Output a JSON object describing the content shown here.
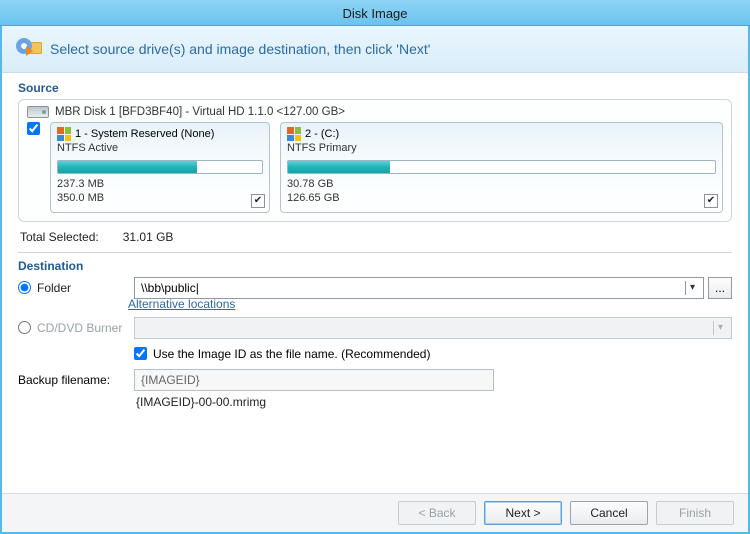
{
  "title": "Disk Image",
  "banner": "Select source drive(s) and image destination, then click 'Next'",
  "source": {
    "heading": "Source",
    "disk_label": "MBR Disk 1 [BFD3BF40] - Virtual HD 1.1.0  <127.00 GB>",
    "partitions": [
      {
        "title": "1 - System Reserved (None)",
        "fs": "NTFS Active",
        "used": "237.3 MB",
        "total": "350.0 MB",
        "pct": 68
      },
      {
        "title": "2 -  (C:)",
        "fs": "NTFS Primary",
        "used": "30.78 GB",
        "total": "126.65 GB",
        "pct": 24
      }
    ],
    "total_label": "Total Selected:",
    "total_value": "31.01 GB"
  },
  "dest": {
    "heading": "Destination",
    "folder_label": "Folder",
    "folder_value": "\\\\bb\\public|",
    "alt_link": "Alternative locations",
    "burner_label": "CD/DVD Burner",
    "use_imageid_label": "Use the Image ID as the file name.  (Recommended)",
    "filename_label": "Backup filename:",
    "filename_value": "{IMAGEID}",
    "preview": "{IMAGEID}-00-00.mrimg"
  },
  "buttons": {
    "back": "< Back",
    "next": "Next >",
    "cancel": "Cancel",
    "finish": "Finish"
  }
}
